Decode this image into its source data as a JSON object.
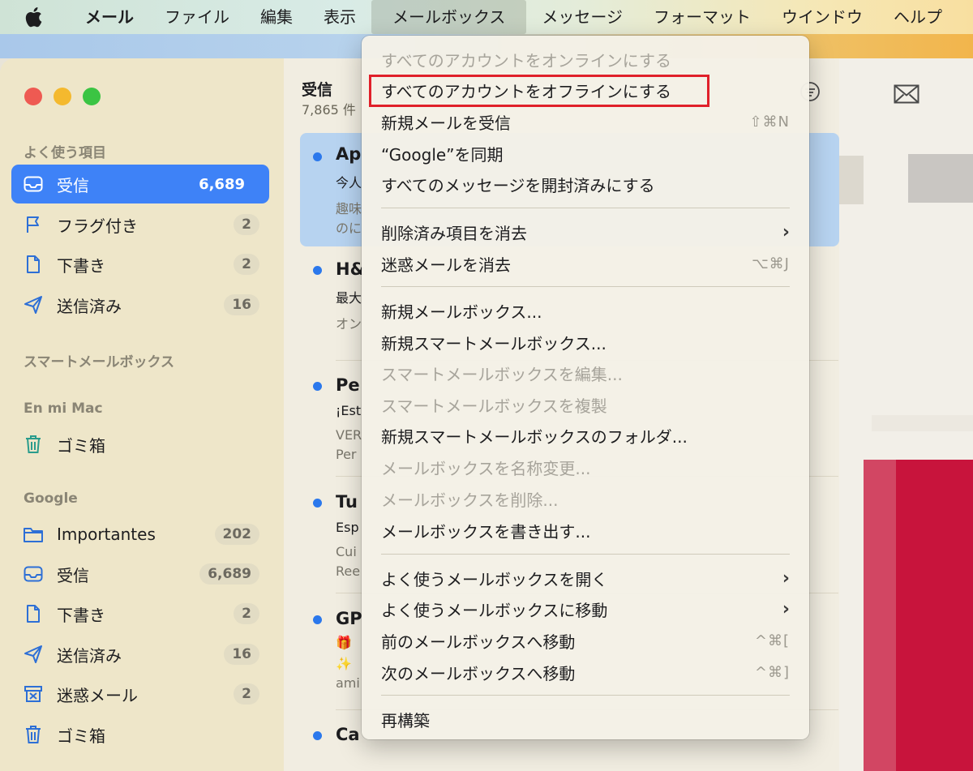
{
  "menubar": {
    "app_name": "メール",
    "items": [
      "ファイル",
      "編集",
      "表示",
      "メールボックス",
      "メッセージ",
      "フォーマット",
      "ウインドウ",
      "ヘルプ"
    ],
    "active_item": "メールボックス"
  },
  "sidebar": {
    "favorites_title": "よく使う項目",
    "favorites": [
      {
        "label": "受信",
        "count": "6,689",
        "icon": "inbox-icon"
      },
      {
        "label": "フラグ付き",
        "count": "2",
        "icon": "flag-icon"
      },
      {
        "label": "下書き",
        "count": "2",
        "icon": "document-icon"
      },
      {
        "label": "送信済み",
        "count": "16",
        "icon": "paperplane-icon"
      }
    ],
    "smart_title": "スマートメールボックス",
    "mac_title": "En mi Mac",
    "mac_items": [
      {
        "label": "ゴミ箱",
        "icon": "trash-icon"
      }
    ],
    "google_title": "Google",
    "google_items": [
      {
        "label": "Importantes",
        "count": "202",
        "icon": "folder-icon"
      },
      {
        "label": "受信",
        "count": "6,689",
        "icon": "inbox-icon"
      },
      {
        "label": "下書き",
        "count": "2",
        "icon": "document-icon"
      },
      {
        "label": "送信済み",
        "count": "16",
        "icon": "paperplane-icon"
      },
      {
        "label": "迷惑メール",
        "count": "2",
        "icon": "junk-icon"
      },
      {
        "label": "ゴミ箱",
        "icon": "trash-icon"
      }
    ]
  },
  "list": {
    "title": "受信",
    "subtitle": "7,865 件",
    "messages": [
      {
        "sender": "Ap",
        "lines": [
          "今人",
          "趣味",
          "のに"
        ]
      },
      {
        "sender": "H&",
        "lines": [
          "最大",
          "オン"
        ]
      },
      {
        "sender": "Pe",
        "lines": [
          "¡Est",
          "VER",
          "Per"
        ]
      },
      {
        "sender": "Tu",
        "lines": [
          "Esp",
          "Cui",
          "Ree"
        ]
      },
      {
        "sender": "GP",
        "lines": [
          "🎁",
          "✨",
          "ami"
        ]
      },
      {
        "sender": "Ca",
        "lines": []
      }
    ]
  },
  "dropdown": {
    "items": [
      {
        "label": "すべてのアカウントをオンラインにする",
        "disabled": true
      },
      {
        "label": "すべてのアカウントをオフラインにする",
        "highlighted": true
      },
      {
        "label": "新規メールを受信",
        "shortcut": "⇧⌘N"
      },
      {
        "label": "“Google”を同期"
      },
      {
        "label": "すべてのメッセージを開封済みにする"
      },
      {
        "label": "削除済み項目を消去",
        "submenu": true
      },
      {
        "label": "迷惑メールを消去",
        "shortcut": "⌥⌘J"
      },
      {
        "label": "新規メールボックス..."
      },
      {
        "label": "新規スマートメールボックス..."
      },
      {
        "label": "スマートメールボックスを編集...",
        "disabled": true
      },
      {
        "label": "スマートメールボックスを複製",
        "disabled": true
      },
      {
        "label": "新規スマートメールボックスのフォルダ..."
      },
      {
        "label": "メールボックスを名称変更...",
        "disabled": true
      },
      {
        "label": "メールボックスを削除...",
        "disabled": true
      },
      {
        "label": "メールボックスを書き出す..."
      },
      {
        "label": "よく使うメールボックスを開く",
        "submenu": true
      },
      {
        "label": "よく使うメールボックスに移動",
        "submenu": true
      },
      {
        "label": "前のメールボックスへ移動",
        "shortcut": "^⌘["
      },
      {
        "label": "次のメールボックスへ移動",
        "shortcut": "^⌘]"
      },
      {
        "label": "再構築"
      }
    ]
  },
  "colors": {
    "accent": "#3e82f7",
    "highlight_border": "#e0202a",
    "unread_dot": "#2b78ec"
  }
}
